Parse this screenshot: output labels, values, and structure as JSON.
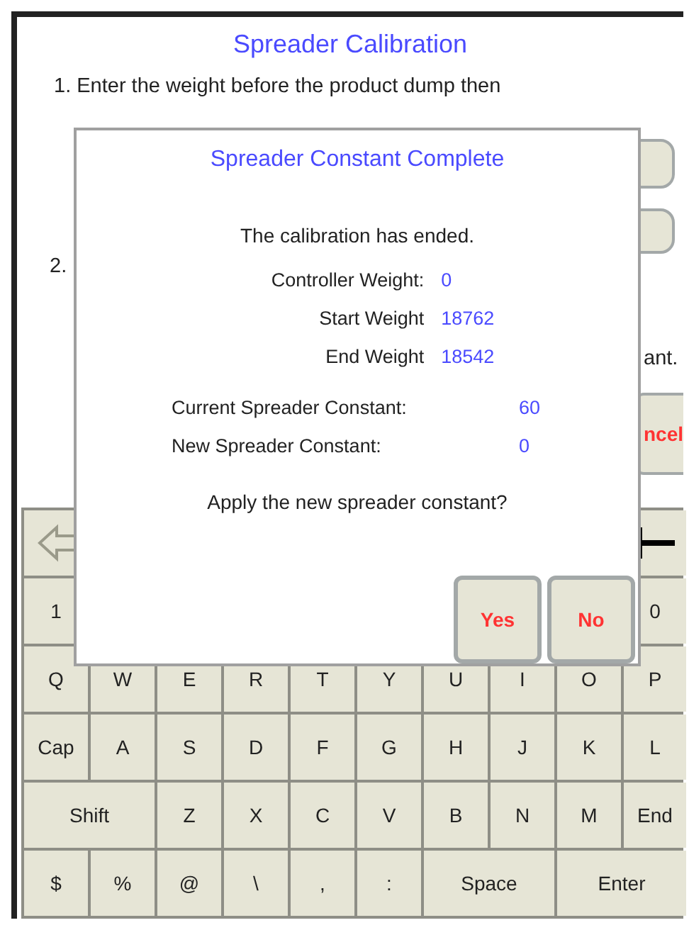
{
  "screen": {
    "title": "Spreader Calibration",
    "step_1": "1. Enter the weight before the product dump then",
    "step_2": "2.",
    "step_2_tail": "ant.",
    "side_buttons": [
      {
        "kind": "plain"
      },
      {
        "kind": "plain"
      },
      {
        "kind": "cancel",
        "label": "ncel"
      }
    ]
  },
  "keyboard": {
    "rows": [
      {
        "keys": [
          {
            "kind": "backspace"
          },
          {
            "kind": "end-mark"
          }
        ]
      },
      {
        "keys": [
          {
            "kind": "char",
            "label": "1"
          },
          {
            "kind": "char",
            "label": "0"
          }
        ]
      },
      {
        "keys": [
          {
            "kind": "char",
            "label": "Q"
          },
          {
            "kind": "char",
            "label": "W"
          },
          {
            "kind": "char",
            "label": "E"
          },
          {
            "kind": "char",
            "label": "R"
          },
          {
            "kind": "char",
            "label": "T"
          },
          {
            "kind": "char",
            "label": "Y"
          },
          {
            "kind": "char",
            "label": "U"
          },
          {
            "kind": "char",
            "label": "I"
          },
          {
            "kind": "char",
            "label": "O"
          },
          {
            "kind": "char",
            "label": "P"
          }
        ]
      },
      {
        "keys": [
          {
            "kind": "char",
            "label": "Cap"
          },
          {
            "kind": "char",
            "label": "A"
          },
          {
            "kind": "char",
            "label": "S"
          },
          {
            "kind": "char",
            "label": "D"
          },
          {
            "kind": "char",
            "label": "F"
          },
          {
            "kind": "char",
            "label": "G"
          },
          {
            "kind": "char",
            "label": "H"
          },
          {
            "kind": "char",
            "label": "J"
          },
          {
            "kind": "char",
            "label": "K"
          },
          {
            "kind": "char",
            "label": "L"
          }
        ]
      },
      {
        "keys": [
          {
            "kind": "wide",
            "label": "Shift"
          },
          {
            "kind": "char",
            "label": "Z"
          },
          {
            "kind": "char",
            "label": "X"
          },
          {
            "kind": "char",
            "label": "C"
          },
          {
            "kind": "char",
            "label": "V"
          },
          {
            "kind": "char",
            "label": "B"
          },
          {
            "kind": "char",
            "label": "N"
          },
          {
            "kind": "char",
            "label": "M"
          },
          {
            "kind": "char",
            "label": "End"
          }
        ]
      },
      {
        "keys": [
          {
            "kind": "char",
            "label": "$"
          },
          {
            "kind": "char",
            "label": "%"
          },
          {
            "kind": "char",
            "label": "@"
          },
          {
            "kind": "char",
            "label": "\\"
          },
          {
            "kind": "char",
            "label": ","
          },
          {
            "kind": "char",
            "label": ":"
          },
          {
            "kind": "wide",
            "label": "Space"
          },
          {
            "kind": "wide",
            "label": "Enter"
          }
        ]
      }
    ]
  },
  "dialog": {
    "title": "Spreader Constant Complete",
    "message": "The calibration has ended.",
    "weights": [
      {
        "label": "Controller Weight:",
        "value": "0"
      },
      {
        "label": "Start Weight",
        "value": "18762"
      },
      {
        "label": "End Weight",
        "value": "18542"
      }
    ],
    "constants": [
      {
        "label": "Current Spreader Constant:",
        "value": "60"
      },
      {
        "label": "New Spreader Constant:",
        "value": "0"
      }
    ],
    "question": "Apply the new spreader constant?",
    "buttons": [
      "Yes",
      "No"
    ]
  }
}
